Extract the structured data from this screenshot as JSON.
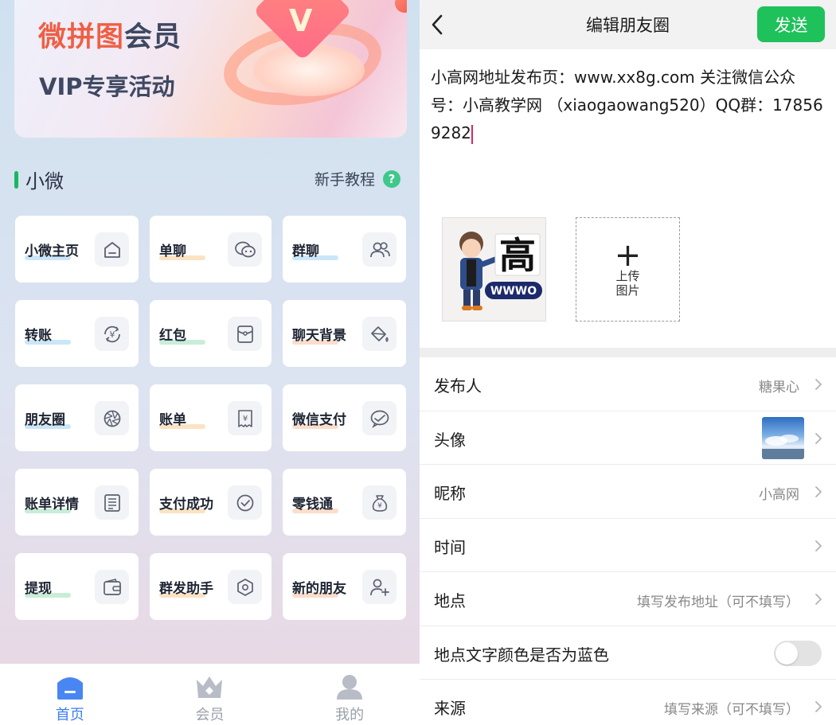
{
  "left": {
    "banner": {
      "title_highlight": "微拼图",
      "title_rest": "会员",
      "subtitle": "VIP专享活动",
      "gem_letter": "V"
    },
    "section": {
      "title": "小微",
      "tutorial_label": "新手教程",
      "tutorial_icon": "?"
    },
    "tools": [
      {
        "label": "小微主页",
        "icon": "home-icon",
        "accent": "#8bc7f0"
      },
      {
        "label": "单聊",
        "icon": "chat-bubbles-icon",
        "accent": "#f5c27a"
      },
      {
        "label": "群聊",
        "icon": "group-icon",
        "accent": "#8bc7f0"
      },
      {
        "label": "转账",
        "icon": "yuan-exchange-icon",
        "accent": "#8bc7f0"
      },
      {
        "label": "红包",
        "icon": "red-packet-icon",
        "accent": "#88d8a8"
      },
      {
        "label": "聊天背景",
        "icon": "paint-bucket-icon",
        "accent": "#f5b58c"
      },
      {
        "label": "朋友圈",
        "icon": "aperture-icon",
        "accent": "#8bc7f0"
      },
      {
        "label": "账单",
        "icon": "receipt-yuan-icon",
        "accent": "#f5c27a"
      },
      {
        "label": "微信支付",
        "icon": "wechat-pay-icon",
        "accent": "#f5b58c"
      },
      {
        "label": "账单详情",
        "icon": "document-list-icon",
        "accent": "#88d8a8"
      },
      {
        "label": "支付成功",
        "icon": "check-circle-icon",
        "accent": "#f5c27a"
      },
      {
        "label": "零钱通",
        "icon": "money-bag-icon",
        "accent": "#f5b58c"
      },
      {
        "label": "提现",
        "icon": "wallet-icon",
        "accent": "#88d8a8"
      },
      {
        "label": "群发助手",
        "icon": "hexagon-icon",
        "accent": "#f5c27a"
      },
      {
        "label": "新的朋友",
        "icon": "add-user-icon",
        "accent": "#f5b58c"
      }
    ],
    "tabbar": [
      {
        "label": "首页",
        "icon": "home-tab-icon",
        "active": true
      },
      {
        "label": "会员",
        "icon": "crown-icon",
        "active": false
      },
      {
        "label": "我的",
        "icon": "person-icon",
        "active": false
      }
    ]
  },
  "right": {
    "nav": {
      "title": "编辑朋友圈",
      "send_label": "发送"
    },
    "post_text": "小高网地址发布页：www.xx8g.com  关注微信公众号：小高教学网 （xiaogaowang520）QQ群：178569282",
    "image": {
      "sign_text": "高",
      "badge_text": "WWWO"
    },
    "upload_label": "上传图片",
    "rows": [
      {
        "label": "发布人",
        "value": "糖果心",
        "kind": "value"
      },
      {
        "label": "头像",
        "value": "",
        "kind": "avatar"
      },
      {
        "label": "昵称",
        "value": "小高网",
        "kind": "value"
      },
      {
        "label": "时间",
        "value": "",
        "kind": "value"
      },
      {
        "label": "地点",
        "value": "填写发布地址（可不填写）",
        "kind": "value"
      },
      {
        "label": "地点文字颜色是否为蓝色",
        "value": "",
        "kind": "toggle"
      },
      {
        "label": "来源",
        "value": "填写来源（可不填写）",
        "kind": "value"
      }
    ]
  }
}
